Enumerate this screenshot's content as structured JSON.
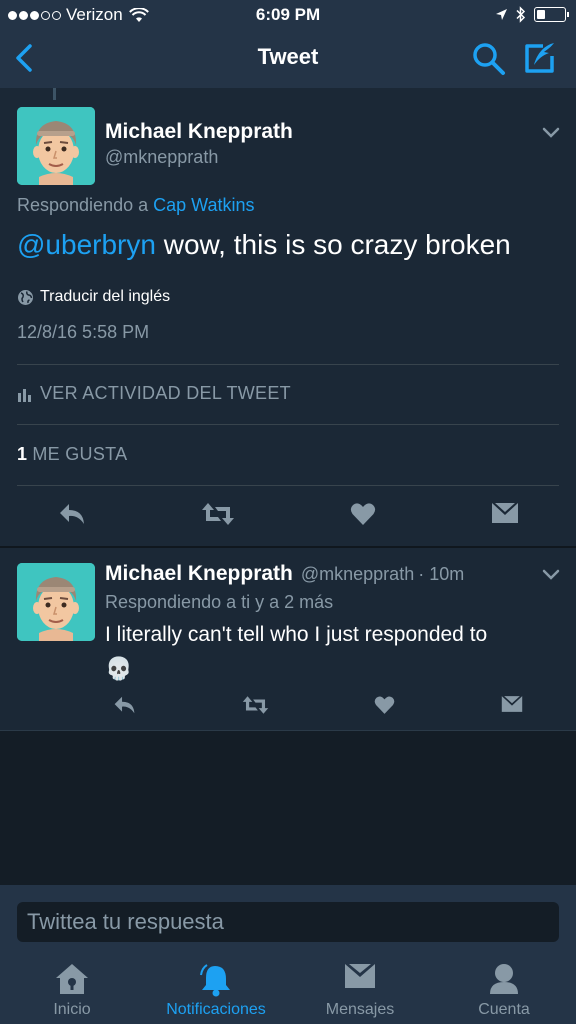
{
  "status_bar": {
    "carrier": "Verizon",
    "time": "6:09 PM",
    "signal_bars_filled": 3,
    "signal_bars_total": 5,
    "battery_level": 0.3
  },
  "nav": {
    "title": "Tweet",
    "back_icon": "chevron-left-icon",
    "search_icon": "search-icon",
    "compose_icon": "compose-icon"
  },
  "main_tweet": {
    "author_name": "Michael Knepprath",
    "author_handle": "@mknepprath",
    "replying_prefix": "Respondiendo a",
    "replying_to": "Cap Watkins",
    "mention": "@uberbryn",
    "text": " wow, this is so crazy broken",
    "translate_label": "Traducir del inglés",
    "timestamp": "12/8/16 5:58 PM",
    "activity_label": "VER ACTIVIDAD DEL TWEET",
    "likes_count": "1",
    "likes_label": "ME GUSTA"
  },
  "reply_tweet": {
    "author_name": "Michael Knepprath",
    "author_handle": "@mknepprath",
    "age": "· 10m",
    "replying": "Respondiendo a ti y a 2 más",
    "text": "I literally can't tell who I just responded to",
    "emoji": "💀"
  },
  "composer": {
    "placeholder": "Twittea tu respuesta"
  },
  "tabs": [
    {
      "label": "Inicio",
      "icon": "home-icon",
      "active": false
    },
    {
      "label": "Notificaciones",
      "icon": "bell-icon",
      "active": true
    },
    {
      "label": "Mensajes",
      "icon": "envelope-icon",
      "active": false
    },
    {
      "label": "Cuenta",
      "icon": "person-icon",
      "active": false
    }
  ],
  "colors": {
    "accent": "#1da1f2",
    "background": "#141d26",
    "card": "#1b2836",
    "bar": "#243447",
    "muted": "#8899a6"
  }
}
